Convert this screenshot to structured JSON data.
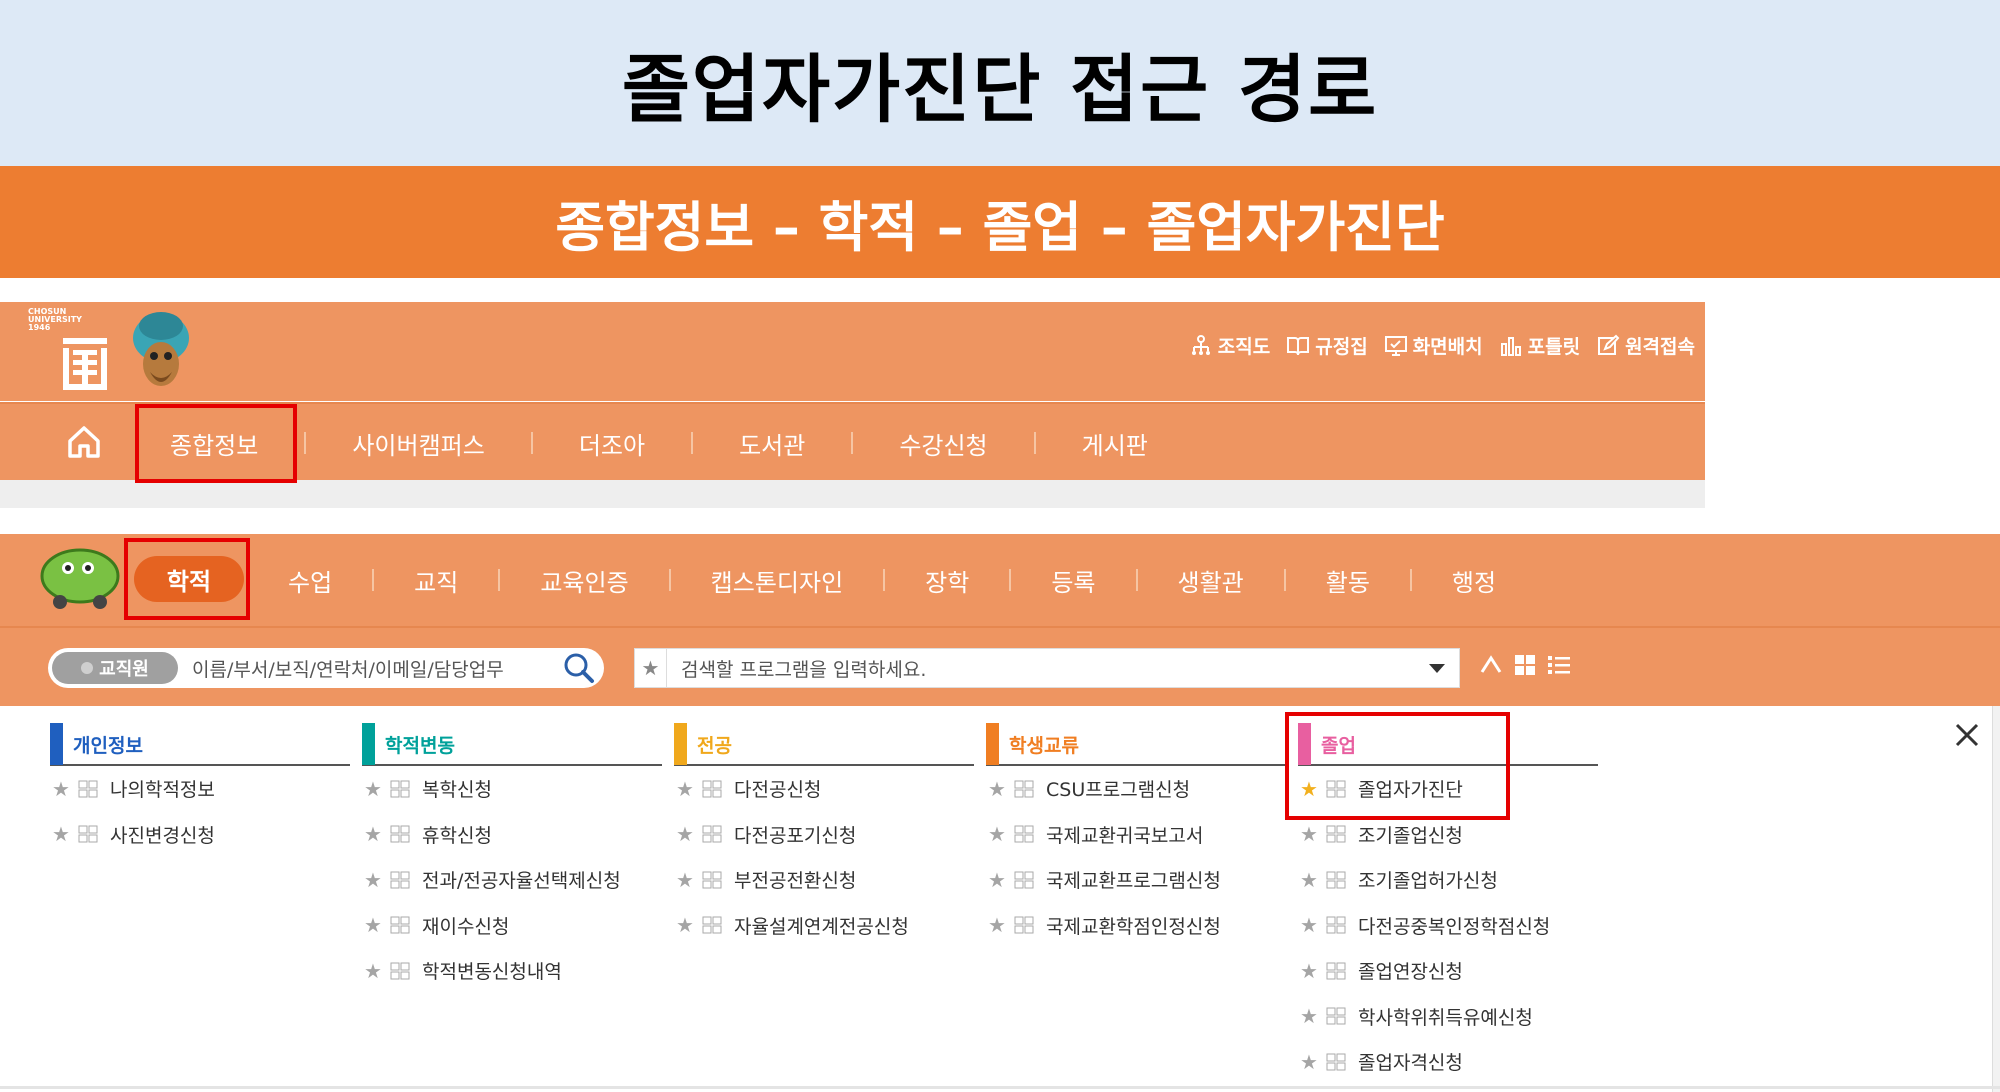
{
  "page": {
    "title": "졸업자가진단 접근 경로",
    "path": "종합정보 – 학적 – 졸업 – 졸업자가진단"
  },
  "portal": {
    "logo_text": "CHOSUN\nUNIVERSITY\n1946",
    "top_links": [
      {
        "icon": "org-chart-icon",
        "label": "조직도"
      },
      {
        "icon": "book-icon",
        "label": "규정집"
      },
      {
        "icon": "monitor-icon",
        "label": "화면배치"
      },
      {
        "icon": "bar-chart-icon",
        "label": "포틀릿"
      },
      {
        "icon": "edit-icon",
        "label": "원격접속"
      }
    ],
    "nav": [
      "종합정보",
      "사이버캠퍼스",
      "더조아",
      "도서관",
      "수강신청",
      "게시판"
    ]
  },
  "submenu": {
    "active": "학적",
    "items": [
      "수업",
      "교직",
      "교육인증",
      "캡스톤디자인",
      "장학",
      "등록",
      "생활관",
      "활동",
      "행정"
    ],
    "search_people": {
      "tag": "교직원",
      "placeholder": "이름/부서/보직/연락처/이메일/담당업무"
    },
    "search_program": {
      "placeholder": "검색할 프로그램을 입력하세요."
    }
  },
  "menu_columns": [
    {
      "title": "개인정보",
      "color": "#1f5fbf",
      "items": [
        {
          "label": "나의학적정보",
          "starred": false
        },
        {
          "label": "사진변경신청",
          "starred": false
        }
      ]
    },
    {
      "title": "학적변동",
      "color": "#00a19a",
      "items": [
        {
          "label": "복학신청",
          "starred": false
        },
        {
          "label": "휴학신청",
          "starred": false
        },
        {
          "label": "전과/전공자율선택제신청",
          "starred": false
        },
        {
          "label": "재이수신청",
          "starred": false
        },
        {
          "label": "학적변동신청내역",
          "starred": false
        }
      ]
    },
    {
      "title": "전공",
      "color": "#f0a81c",
      "items": [
        {
          "label": "다전공신청",
          "starred": false
        },
        {
          "label": "다전공포기신청",
          "starred": false
        },
        {
          "label": "부전공전환신청",
          "starred": false
        },
        {
          "label": "자율설계연계전공신청",
          "starred": false
        }
      ]
    },
    {
      "title": "학생교류",
      "color": "#f07e22",
      "items": [
        {
          "label": "CSU프로그램신청",
          "starred": false
        },
        {
          "label": "국제교환귀국보고서",
          "starred": false
        },
        {
          "label": "국제교환프로그램신청",
          "starred": false
        },
        {
          "label": "국제교환학점인정신청",
          "starred": false
        }
      ]
    },
    {
      "title": "졸업",
      "color": "#e85fa0",
      "items": [
        {
          "label": "졸업자가진단",
          "starred": true
        },
        {
          "label": "조기졸업신청",
          "starred": false
        },
        {
          "label": "조기졸업허가신청",
          "starred": false
        },
        {
          "label": "다전공중복인정학점신청",
          "starred": false
        },
        {
          "label": "졸업연장신청",
          "starred": false
        },
        {
          "label": "학사학위취득유예신청",
          "starred": false
        },
        {
          "label": "졸업자격신청",
          "starred": false
        }
      ]
    }
  ]
}
